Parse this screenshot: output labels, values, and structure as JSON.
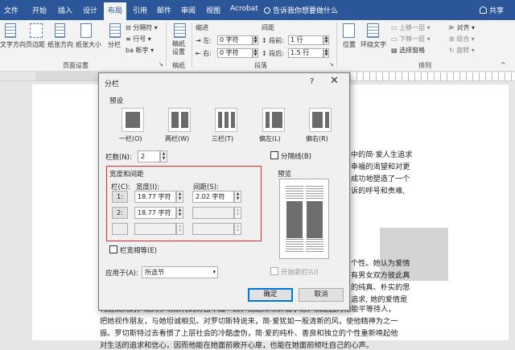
{
  "tabs": [
    "文件",
    "开始",
    "插入",
    "设计",
    "布局",
    "引用",
    "邮件",
    "审阅",
    "视图",
    "Acrobat"
  ],
  "active_tab": "布局",
  "tell_me": "告诉我你想要做什么",
  "user_label": "共享",
  "ribbon": {
    "text_direction": "文字方向",
    "margins": "页边距",
    "orientation": "纸张方向",
    "size": "纸张大小",
    "columns": "分栏",
    "breaks": "分隔符",
    "line_numbers": "行号",
    "hyphenation": "断字",
    "page_setup_group": "页面设置",
    "draft_paper": "稿纸设置",
    "draft_group": "稿纸",
    "indent_title": "缩进",
    "spacing_title": "间距",
    "indent_left_label": "左:",
    "indent_left_value": "0 字符",
    "indent_right_label": "右:",
    "indent_right_value": "0 字符",
    "spacing_before_label": "段前:",
    "spacing_before_value": "1 行",
    "spacing_after_label": "段后:",
    "spacing_after_value": "1.5 行",
    "paragraph_group": "段落",
    "position": "位置",
    "wrap_text": "环绕文字",
    "bring_forward": "上移一层",
    "send_backward": "下移一层",
    "selection_pane": "选择窗格",
    "align": "对齐",
    "group": "组合",
    "rotate": "旋转",
    "arrange_group": "排列"
  },
  "document": {
    "right_lines": [
      "中的简·爱人生追求",
      "幸福的渴望和对更",
      "成功地塑造了一个",
      "诉的呼号和责难,"
    ],
    "right_lower_lines": [
      "个性。她认为爱情",
      "有男女双方彼此真",
      "的纯真、朴实的思",
      "追求, 她的爱情是"
    ],
    "bottom_lines": [
      "纯洁高尚的，她对罗切斯特的财富不屑一顾，她之所以钟情于他，就是因为他能平等待人，",
      "把她视作朋友，与她坦诚相见。对罗切斯特说来，简·爱犹如一股清新的风，使他精神为之一",
      "振。罗切斯特过去看惯了上层社会的冷酷虚伪，简·爱的纯朴、善良和独立的个性重新唤起他",
      "对生活的追求和信心，因而他能在她面前敞开心扉，也能在她面前倾吐自己的心声。"
    ]
  },
  "dialog": {
    "title": "分栏",
    "help": "?",
    "close": "✕",
    "presets_label": "预设",
    "presets": [
      "一栏(O)",
      "两栏(W)",
      "三栏(T)",
      "偏左(L)",
      "偏右(R)"
    ],
    "num_columns_label": "栏数(N):",
    "num_columns_value": "2",
    "line_between_label": "分隔线(B)",
    "width_spacing_label": "宽度和间距",
    "preview_label": "预览",
    "col_header": "栏(C):",
    "width_header": "宽度(I):",
    "spacing_header": "间距(S):",
    "rows": [
      {
        "num": "1:",
        "width": "18.77 字符",
        "spacing": "2.02 字符"
      },
      {
        "num": "2:",
        "width": "18.77 字符",
        "spacing": ""
      },
      {
        "num": "",
        "width": "",
        "spacing": ""
      }
    ],
    "equal_width_label": "栏宽相等(E)",
    "apply_to_label": "应用于(A):",
    "apply_to_value": "所选节",
    "new_column_label": "开始新栏(U)",
    "ok": "确定",
    "cancel": "取消"
  }
}
